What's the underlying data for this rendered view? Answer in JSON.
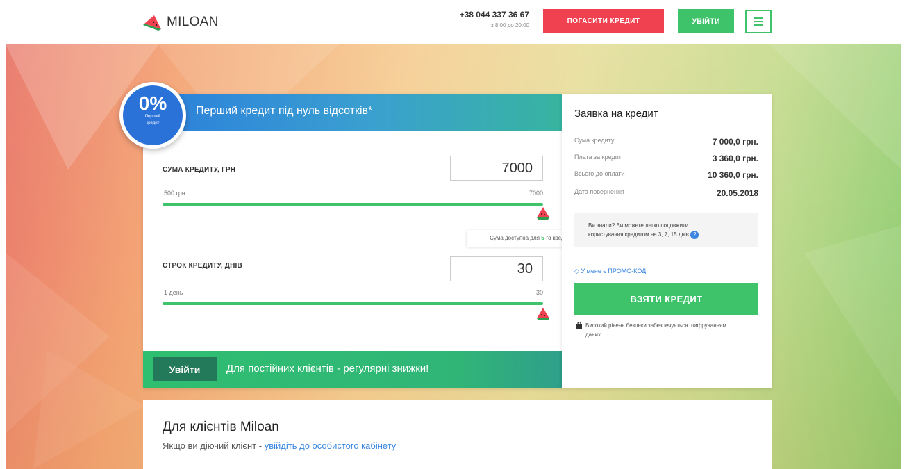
{
  "header": {
    "logo_text": "MILOAN",
    "phone": "+38 044 337 36 67",
    "hours": "з 8:00 до 20:00",
    "repay_label": "ПОГАСИТИ КРЕДИТ",
    "login_label": "УВІЙТИ",
    "menu_icon": "hamburger-icon"
  },
  "calculator": {
    "badge_pct": "0%",
    "badge_line1": "Перший",
    "badge_line2": "кредит",
    "title": "Перший кредит під нуль відсотків*",
    "amount": {
      "label": "СУМА КРЕДИТУ, ГРН",
      "value": "7000",
      "min_label": "500 грн",
      "max_label": "7000",
      "fill_fraction": 1.0
    },
    "tooltip": {
      "prefix": "Сума доступна для",
      "highlight": "5",
      "suffix": "-го кредиту"
    },
    "term": {
      "label": "СТРОК КРЕДИТУ, ДНІВ",
      "value": "30",
      "min_label": "1 день",
      "max_label": "30",
      "fill_fraction": 1.0
    },
    "footer": {
      "login_label": "Увійти",
      "text": "Для постійних клієнтів - регулярні знижки!"
    }
  },
  "application": {
    "title": "Заявка на кредит",
    "rows": [
      {
        "key": "Сума кредиту",
        "value": "7 000,0 грн."
      },
      {
        "key": "Плата за кредит",
        "value": "3 360,0 грн."
      },
      {
        "key": "Всього до оплати",
        "value": "10 360,0 грн."
      },
      {
        "key": "Дата повернення",
        "value": "20.05.2018"
      }
    ],
    "info_line1": "Ви знали? Ви можете легко подовжити",
    "info_line2": "користування кредитом на 3, 7, 15 днів",
    "info_icon_text": "?",
    "promo_label": "У мене є ПРОМО-КОД",
    "take_button": "ВЗЯТИ КРЕДИТ",
    "secure_text": "Високий рівень безпеки забезпечується шифруванням даних"
  },
  "clients": {
    "title": "Для клієнтів Miloan",
    "sub_prefix": "Якщо ви діючий клієнт - ",
    "sub_link": "увійдіть до особистого кабінету"
  },
  "colors": {
    "accent_green": "#3ec36b",
    "accent_red": "#ef4150",
    "accent_blue": "#2b72d8"
  }
}
